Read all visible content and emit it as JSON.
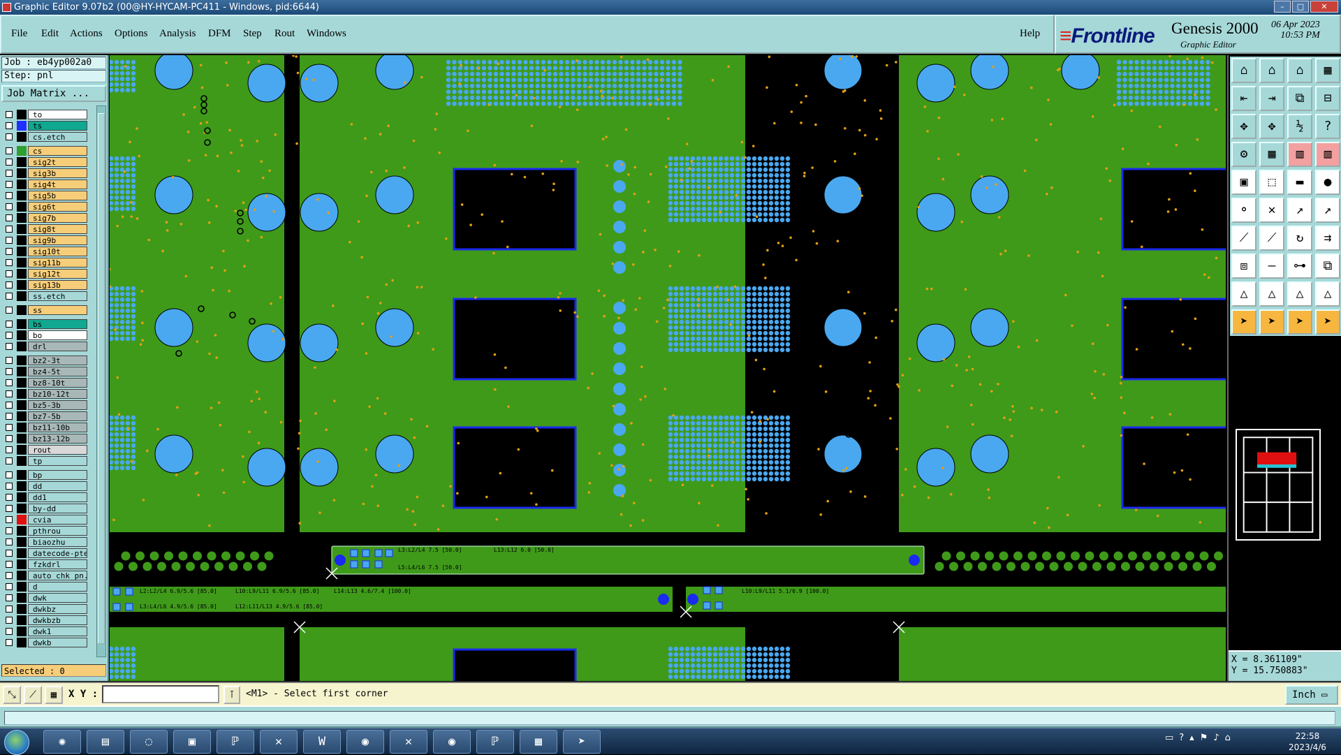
{
  "window": {
    "title": "Graphic Editor 9.07b2 (00@HY-HYCAM-PC411 - Windows, pid:6644)",
    "min": "–",
    "max": "□",
    "close": "✕"
  },
  "menu": [
    "File",
    "Edit",
    "Actions",
    "Options",
    "Analysis",
    "DFM",
    "Step",
    "Rout",
    "Windows"
  ],
  "help": "Help",
  "brand": {
    "logo_a": "≡",
    "logo_b": "Frontline",
    "name": "Genesis 2000",
    "subtitle": "Graphic Editor",
    "date": "06 Apr 2023",
    "time": "10:53 PM"
  },
  "job": "Job : eb4yp002a0",
  "step": "Step: pnl",
  "job_matrix": "Job Matrix ...",
  "layers": [
    {
      "name": "to",
      "color": "#000000",
      "bg": "#ffffff"
    },
    {
      "name": "ts",
      "color": "#2030ff",
      "bg": "#10a890"
    },
    {
      "name": "cs.etch",
      "color": "#000000",
      "bg": "#a6d8d8"
    },
    {
      "name": "cs",
      "color": "#30a030",
      "bg": "#f6ce7a"
    },
    {
      "name": "sig2t",
      "color": "#000000",
      "bg": "#f6ce7a"
    },
    {
      "name": "sig3b",
      "color": "#000000",
      "bg": "#f6ce7a"
    },
    {
      "name": "sig4t",
      "color": "#000000",
      "bg": "#f6ce7a"
    },
    {
      "name": "sig5b",
      "color": "#000000",
      "bg": "#f6ce7a"
    },
    {
      "name": "sig6t",
      "color": "#000000",
      "bg": "#f6ce7a"
    },
    {
      "name": "sig7b",
      "color": "#000000",
      "bg": "#f6ce7a"
    },
    {
      "name": "sig8t",
      "color": "#000000",
      "bg": "#f6ce7a"
    },
    {
      "name": "sig9b",
      "color": "#000000",
      "bg": "#f6ce7a"
    },
    {
      "name": "sig10t",
      "color": "#000000",
      "bg": "#f6ce7a"
    },
    {
      "name": "sig11b",
      "color": "#000000",
      "bg": "#f6ce7a"
    },
    {
      "name": "sig12t",
      "color": "#000000",
      "bg": "#f6ce7a"
    },
    {
      "name": "sig13b",
      "color": "#000000",
      "bg": "#f6ce7a"
    },
    {
      "name": "ss.etch",
      "color": "#000000",
      "bg": "#a6d8d8"
    },
    {
      "name": "ss",
      "color": "#000000",
      "bg": "#f6ce7a"
    },
    {
      "name": "bs",
      "color": "#000000",
      "bg": "#10a890"
    },
    {
      "name": "bo",
      "color": "#000000",
      "bg": "#ffffff"
    },
    {
      "name": "drl",
      "color": "#000000",
      "bg": "#a8b8b8"
    },
    {
      "name": "bz2-3t",
      "color": "#000000",
      "bg": "#a8b8b8"
    },
    {
      "name": "bz4-5t",
      "color": "#000000",
      "bg": "#a8b8b8"
    },
    {
      "name": "bz8-10t",
      "color": "#000000",
      "bg": "#a8b8b8"
    },
    {
      "name": "bz10-12t",
      "color": "#000000",
      "bg": "#a8b8b8"
    },
    {
      "name": "bz5-3b",
      "color": "#000000",
      "bg": "#a8b8b8"
    },
    {
      "name": "bz7-5b",
      "color": "#000000",
      "bg": "#a8b8b8"
    },
    {
      "name": "bz11-10b",
      "color": "#000000",
      "bg": "#a8b8b8"
    },
    {
      "name": "bz13-12b",
      "color": "#000000",
      "bg": "#a8b8b8"
    },
    {
      "name": "rout",
      "color": "#000000",
      "bg": "#d8d8d8"
    },
    {
      "name": "tp",
      "color": "#000000",
      "bg": "#a6d8d8"
    },
    {
      "name": "bp",
      "color": "#000000",
      "bg": "#a6d8d8"
    },
    {
      "name": "dd",
      "color": "#000000",
      "bg": "#a6d8d8"
    },
    {
      "name": "dd1",
      "color": "#000000",
      "bg": "#a6d8d8"
    },
    {
      "name": "by-dd",
      "color": "#000000",
      "bg": "#a6d8d8"
    },
    {
      "name": "cvia",
      "color": "#e01010",
      "bg": "#a6d8d8"
    },
    {
      "name": "pthrou",
      "color": "#000000",
      "bg": "#a6d8d8"
    },
    {
      "name": "biaozhu",
      "color": "#000000",
      "bg": "#a6d8d8"
    },
    {
      "name": "datecode-pte",
      "color": "#000000",
      "bg": "#a6d8d8"
    },
    {
      "name": "fzkdrl",
      "color": "#000000",
      "bg": "#a6d8d8"
    },
    {
      "name": "auto_chk_pn.",
      "color": "#000000",
      "bg": "#a6d8d8"
    },
    {
      "name": "d",
      "color": "#000000",
      "bg": "#a6d8d8"
    },
    {
      "name": "dwk",
      "color": "#000000",
      "bg": "#a6d8d8"
    },
    {
      "name": "dwkbz",
      "color": "#000000",
      "bg": "#a6d8d8"
    },
    {
      "name": "dwkbzb",
      "color": "#000000",
      "bg": "#a6d8d8"
    },
    {
      "name": "dwk1",
      "color": "#000000",
      "bg": "#a6d8d8"
    },
    {
      "name": "dwkb",
      "color": "#000000",
      "bg": "#a6d8d8"
    }
  ],
  "selected": "Selected : 0",
  "canvas_text": {
    "l1": "L3:L2/L4 7.5 [50.0]",
    "l2": "L13:L12 6.0 [50.0]",
    "l3": "L5:L4/L6 7.5 [50.0]",
    "l4": "L2:L2/L4 6.9/5.6 [85.0]",
    "l5": "L10:L9/L11 6.9/5.6 [85.0]",
    "l6": "L14:L13 4.6/7.4 [100.0]",
    "l7": "L10:L9/L11 5.1/6.9 [100.0]",
    "l8": "L3:L4/L6 4.9/5.6 [85.0]",
    "l9": "L12:L11/L13 4.9/5.6 [85.0]"
  },
  "colors": {
    "laminate": "#3f9a1a",
    "pad": "#4aa8f0",
    "drill": "#e3a012",
    "window": "#000000",
    "copper_outline": "#1a2aee"
  },
  "coords": {
    "x": "X = 8.361109\"",
    "y": "Y = 15.750883\""
  },
  "status": {
    "xy_label": "X Y :",
    "xy_value": "",
    "prompt": "<M1> - Select first corner",
    "unit": "Inch"
  },
  "taskbar": {
    "time": "22:58",
    "date": "2023/4/6"
  }
}
